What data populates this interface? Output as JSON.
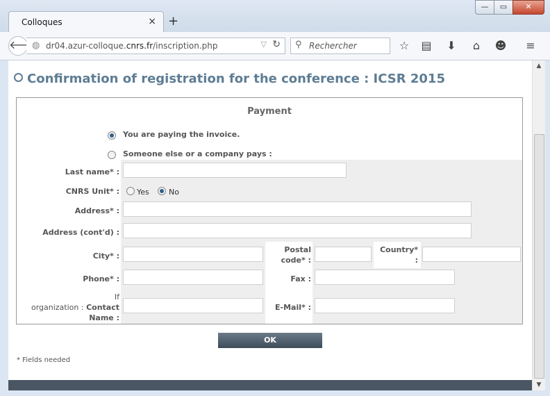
{
  "browser": {
    "tab_title": "Colloques",
    "tab_close": "×",
    "new_tab": "+",
    "url_prefix": "dr04.azur-colloque.",
    "url_domain": "cnrs.fr",
    "url_path": "/inscription.php",
    "search_placeholder": "Rechercher",
    "window_min": "—",
    "window_max": "▭",
    "window_close": "✕"
  },
  "page": {
    "title": "Confirmation of registration for the conference : ICSR 2015",
    "panel_title": "Payment",
    "payer_options": [
      {
        "label": "You are paying the invoice.",
        "selected": true
      },
      {
        "label": "Someone else or a company pays :",
        "selected": false
      }
    ],
    "form": {
      "last_name_label": "Last name* :",
      "cnrs_unit_label": "CNRS Unit* :",
      "cnrs_yes": "Yes",
      "cnrs_no": "No",
      "cnrs_selected": "No",
      "address_label": "Address* :",
      "address_cont_label": "Address (cont'd) :",
      "city_label": "City* :",
      "postal_label_1": "Postal",
      "postal_label_2": "code* :",
      "country_label_1": "Country*",
      "country_label_2": ":",
      "phone_label": "Phone* :",
      "fax_label": "Fax  :",
      "contact_label_1": "If",
      "contact_label_2a": "organization : ",
      "contact_label_2b": "Contact",
      "contact_label_3": "Name :",
      "email_label": "E-Mail* :"
    },
    "ok_button": "OK",
    "footnote": "* Fields needed"
  }
}
